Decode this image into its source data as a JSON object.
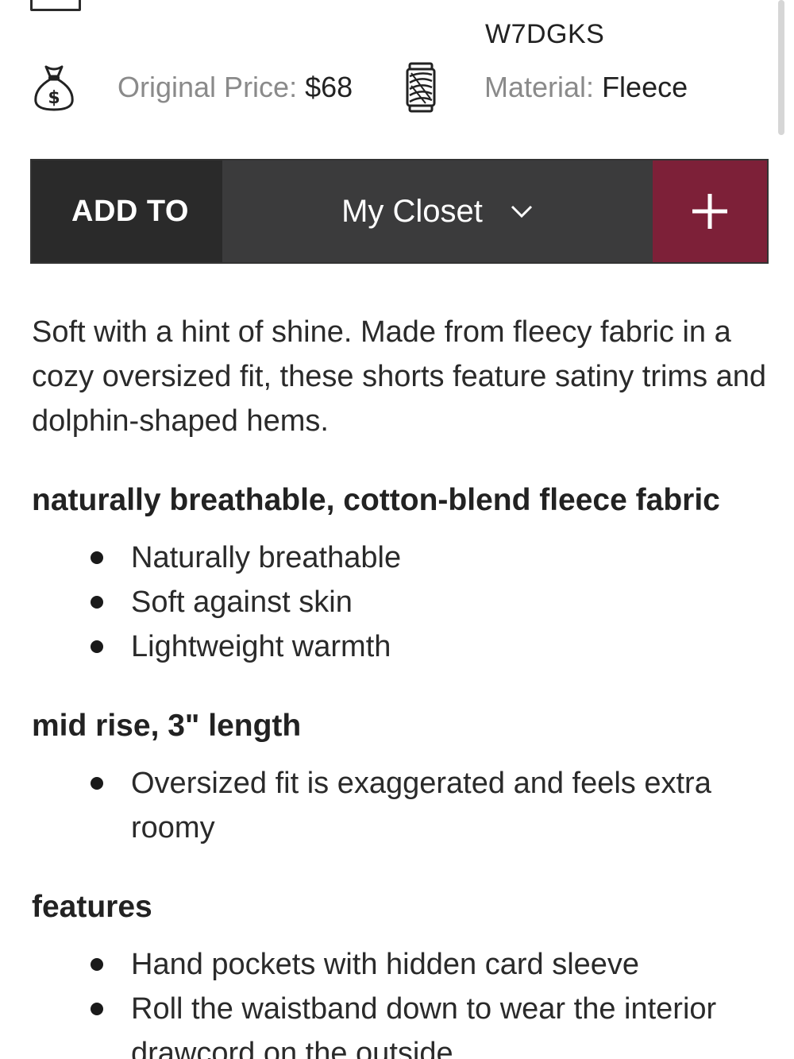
{
  "details": {
    "sku_value": "W7DGKS",
    "original_price": {
      "label": "Original Price:",
      "value": "$68",
      "icon": "money-bag-icon"
    },
    "material": {
      "label": "Material:",
      "value": "Fleece",
      "icon": "thread-spool-icon"
    }
  },
  "add_bar": {
    "add_to_label": "ADD TO",
    "selected_list": "My Closet",
    "plus_symbol": "+",
    "colors": {
      "dark": "#2a2a2a",
      "select": "#3b3b3c",
      "accent": "#7d2038"
    }
  },
  "description": "Soft with a hint of shine. Made from fleecy fabric in a cozy oversized fit, these shorts feature satiny trims and dolphin-shaped hems.",
  "sections": [
    {
      "title": "naturally breathable, cotton-blend fleece fabric",
      "bullets": [
        "Naturally breathable",
        "Soft against skin",
        "Lightweight warmth"
      ]
    },
    {
      "title": "mid rise, 3\" length",
      "bullets": [
        "Oversized fit is exaggerated and feels extra roomy"
      ]
    },
    {
      "title": "features",
      "bullets": [
        "Hand pockets with hidden card sleeve",
        "Roll the waistband down to wear the interior drawcord on the outside"
      ]
    }
  ]
}
